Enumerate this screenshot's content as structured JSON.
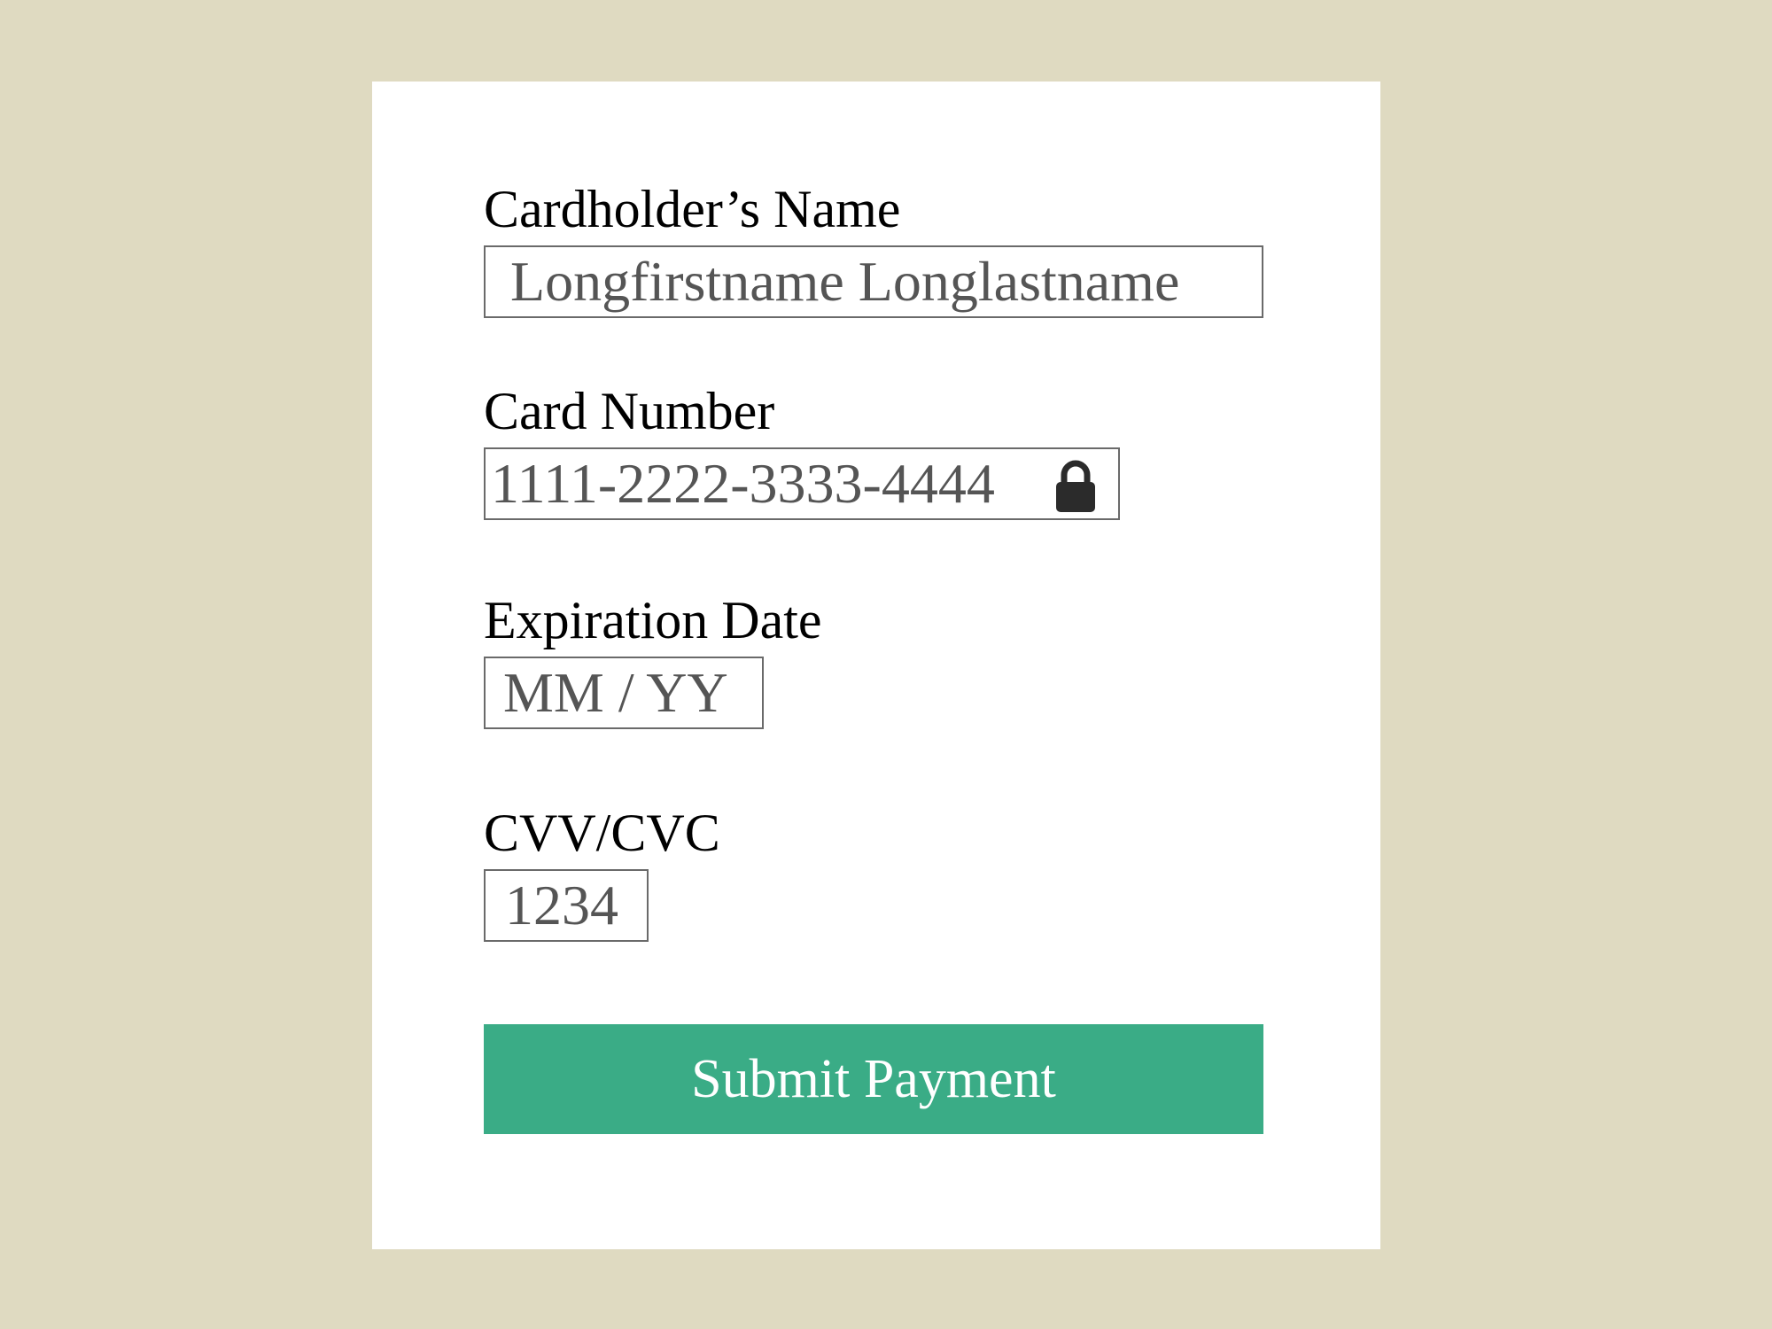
{
  "form": {
    "name": {
      "label": "Cardholder’s Name",
      "value": "Longfirstname Longlastname"
    },
    "card_number": {
      "label": "Card Number",
      "value": "1111-2222-3333-4444",
      "icon": "lock-icon"
    },
    "expiration": {
      "label": "Expiration Date",
      "value": "MM / YY"
    },
    "cvv": {
      "label": "CVV/CVC",
      "value": "1234"
    },
    "submit_label": "Submit Payment"
  },
  "colors": {
    "background": "#dfdac1",
    "card": "#ffffff",
    "button": "#3aac86",
    "button_text": "#ffffff",
    "field_text": "#555555",
    "field_border": "#6a6a6a",
    "icon": "#2b2b2b"
  }
}
